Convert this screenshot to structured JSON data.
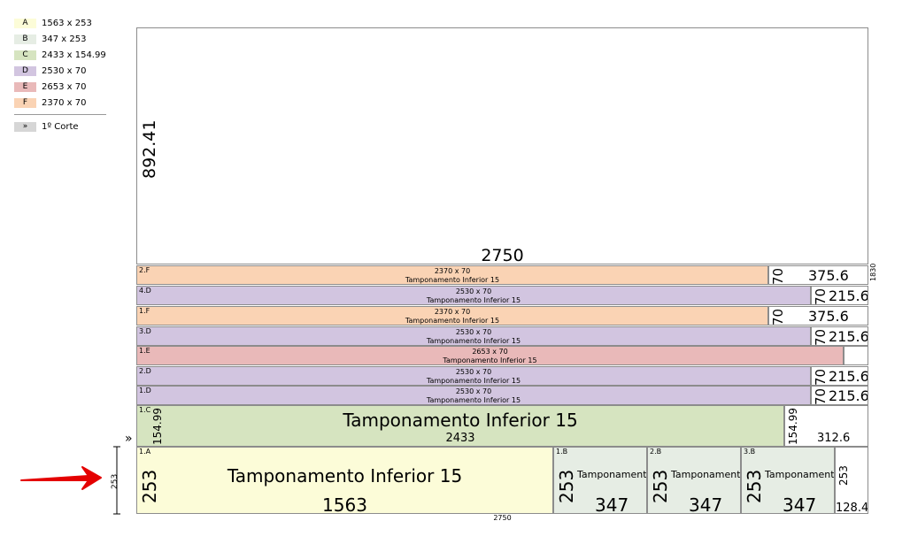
{
  "legend": {
    "items": [
      {
        "letter": "A",
        "size": "1563 x 253",
        "color": "#fcfcd8"
      },
      {
        "letter": "B",
        "size": "347 x 253",
        "color": "#e6ede4"
      },
      {
        "letter": "C",
        "size": "2433 x 154.99",
        "color": "#d6e4c0"
      },
      {
        "letter": "D",
        "size": "2530 x 70",
        "color": "#d2c5e0"
      },
      {
        "letter": "E",
        "size": "2653 x 70",
        "color": "#e9b9b9"
      },
      {
        "letter": "F",
        "size": "2370 x 70",
        "color": "#fad3b4"
      }
    ],
    "cut_button": {
      "icon": "»",
      "label": "1º Corte"
    }
  },
  "sheet": {
    "width_label": "2750",
    "height_label": "1830",
    "waste_top": {
      "width": "2750",
      "height": "892.41"
    }
  },
  "strips": [
    {
      "id": "2.F",
      "size": "2370 x 70",
      "name": "Tamponamento Inferior 15",
      "side_h": "70",
      "side_w": "375.6"
    },
    {
      "id": "4.D",
      "size": "2530 x 70",
      "name": "Tamponamento Inferior 15",
      "side_h": "70",
      "side_w": "215.6"
    },
    {
      "id": "1.F",
      "size": "2370 x 70",
      "name": "Tamponamento Inferior 15",
      "side_h": "70",
      "side_w": "375.6"
    },
    {
      "id": "3.D",
      "size": "2530 x 70",
      "name": "Tamponamento Inferior 15",
      "side_h": "70",
      "side_w": "215.6"
    },
    {
      "id": "1.E",
      "size": "2653 x 70",
      "name": "Tamponamento Inferior 15"
    },
    {
      "id": "2.D",
      "size": "2530 x 70",
      "name": "Tamponamento Inferior 15",
      "side_h": "70",
      "side_w": "215.6"
    },
    {
      "id": "1.D",
      "size": "2530 x 70",
      "name": "Tamponamento Inferior 15",
      "side_h": "70",
      "side_w": "215.6"
    }
  ],
  "strip_c": {
    "id": "1.C",
    "name": "Tamponamento Inferior 15",
    "width": "2433",
    "height": "154.99",
    "side_h": "154.99",
    "side_w": "312.6"
  },
  "strip_bottom": {
    "a": {
      "id": "1.A",
      "name": "Tamponamento Inferior 15",
      "width": "1563",
      "height": "253"
    },
    "bs": [
      {
        "id": "1.B",
        "name": "Tamponamento",
        "width": "347",
        "height": "253"
      },
      {
        "id": "2.B",
        "name": "Tamponamento",
        "width": "347",
        "height": "253"
      },
      {
        "id": "3.B",
        "name": "Tamponamento",
        "width": "347",
        "height": "253"
      }
    ],
    "waste": {
      "height": "253",
      "width": "128.4"
    }
  },
  "dimension": {
    "strip_height": "253",
    "bottom_width": "2750",
    "cut_marker": "»"
  }
}
